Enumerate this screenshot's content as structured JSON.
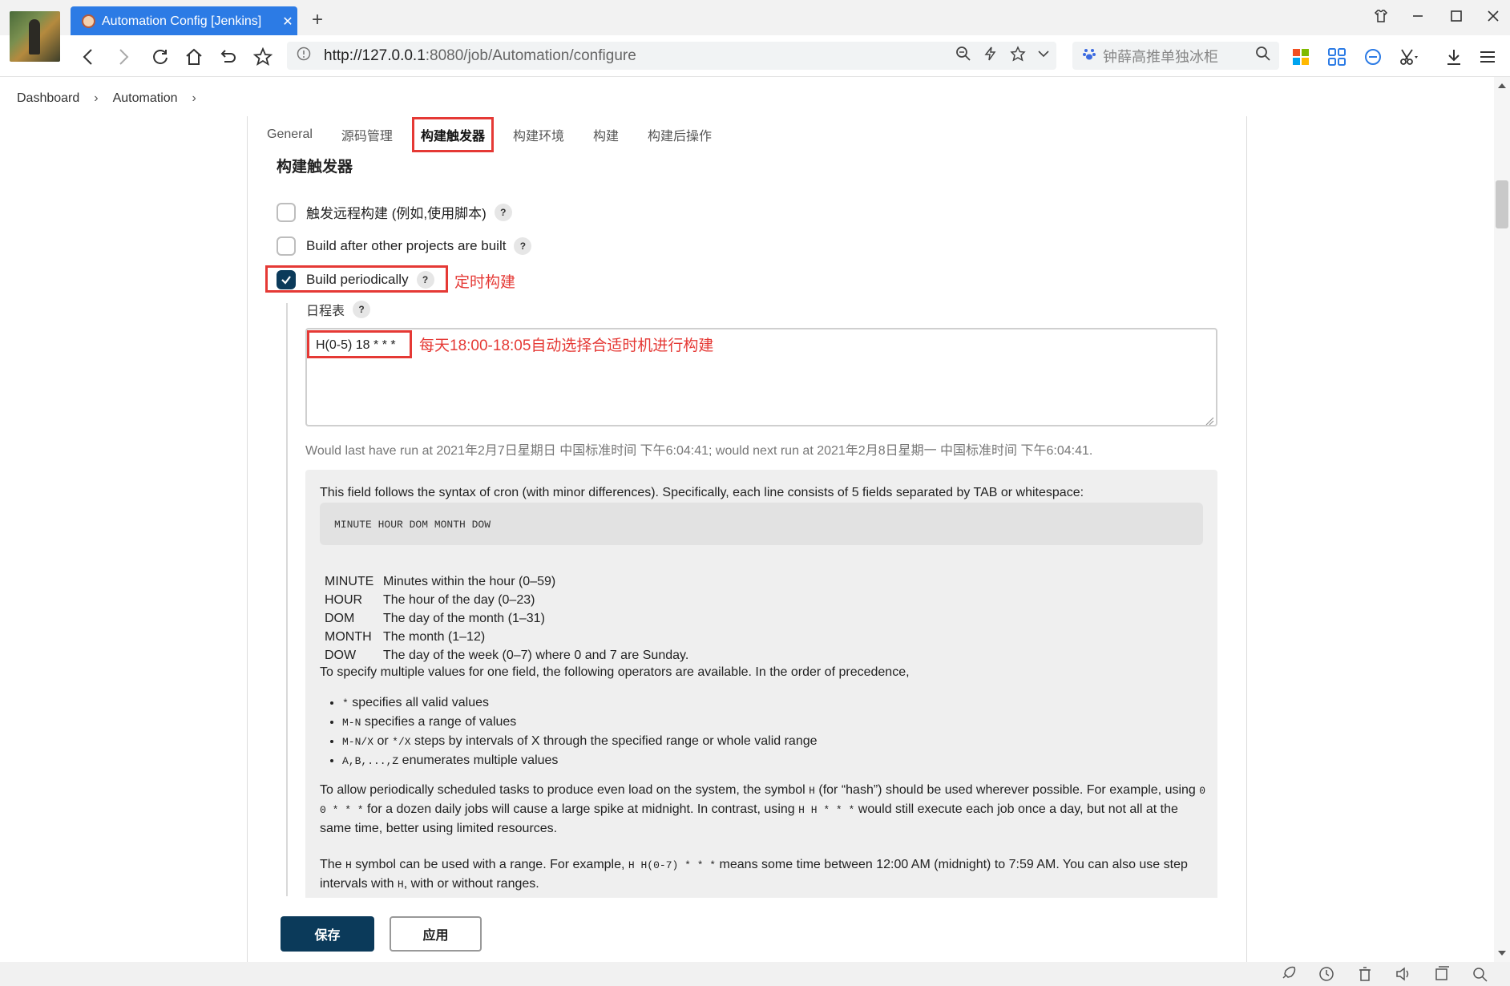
{
  "browser": {
    "tab_title": "Automation Config [Jenkins]",
    "tab_close": "✕",
    "new_tab": "+",
    "url_host": "http://127.0.0.1",
    "url_rest": ":8080/job/Automation/configure",
    "search_placeholder": "钟薛高推单独冰柜"
  },
  "breadcrumb": {
    "items": [
      "Dashboard",
      "Automation"
    ],
    "separator": "›"
  },
  "tabs": [
    "General",
    "源码管理",
    "构建触发器",
    "构建环境",
    "构建",
    "构建后操作"
  ],
  "active_tab": "构建触发器",
  "section_title": "构建触发器",
  "triggers": [
    {
      "label": "触发远程构建 (例如,使用脚本)",
      "checked": false
    },
    {
      "label": "Build after other projects are built",
      "checked": false
    },
    {
      "label": "Build periodically",
      "checked": true
    }
  ],
  "help_label": "?",
  "annotations": {
    "periodic": "定时构建",
    "schedule": "每天18:00-18:05自动选择合适时机进行构建"
  },
  "schedule": {
    "label": "日程表",
    "value": "H(0-5) 18 * * *",
    "run_info": "Would last have run at 2021年2月7日星期日 中国标准时间 下午6:04:41; would next run at 2021年2月8日星期一 中国标准时间 下午6:04:41."
  },
  "help": {
    "intro": "This field follows the syntax of cron (with minor differences). Specifically, each line consists of 5 fields separated by TAB or whitespace:",
    "code": "MINUTE HOUR DOM MONTH DOW",
    "fields": [
      {
        "name": "MINUTE",
        "desc": "Minutes within the hour (0–59)"
      },
      {
        "name": "HOUR",
        "desc": "The hour of the day (0–23)"
      },
      {
        "name": "DOM",
        "desc": "The day of the month (1–31)"
      },
      {
        "name": "MONTH",
        "desc": "The month (1–12)"
      },
      {
        "name": "DOW",
        "desc": "The day of the week (0–7) where 0 and 7 are Sunday."
      }
    ],
    "operators_intro": "To specify multiple values for one field, the following operators are available. In the order of precedence,",
    "operators": [
      {
        "code": "*",
        "text": " specifies all valid values"
      },
      {
        "code": "M-N",
        "text": " specifies a range of values"
      },
      {
        "code": "M-N/X",
        "text": " or ",
        "code2": "*/X",
        "text2": " steps by intervals of X through the specified range or whole valid range"
      },
      {
        "code": "A,B,...,Z",
        "text": " enumerates multiple values"
      }
    ],
    "para_h_1": "To allow periodically scheduled tasks to produce even load on the system, the symbol ",
    "para_h_code": "H",
    "para_h_2": " (for “hash”) should be used wherever possible. For example, using ",
    "para_h_code2": "0 0 * * *",
    "para_h_3": " for a dozen daily jobs will cause a large spike at midnight. In contrast, using ",
    "para_h_code3": "H H * * *",
    "para_h_4": " would still execute each job once a day, but not all at the same time, better using limited resources.",
    "para_r_1": "The ",
    "para_r_code": "H",
    "para_r_2": " symbol can be used with a range. For example, ",
    "para_r_code2": "H H(0-7) * * *",
    "para_r_3": " means some time between 12:00 AM (midnight) to 7:59 AM. You can also use step intervals with ",
    "para_r_code3": "H",
    "para_r_4": ", with or without ranges."
  },
  "buttons": {
    "save": "保存",
    "apply": "应用"
  }
}
